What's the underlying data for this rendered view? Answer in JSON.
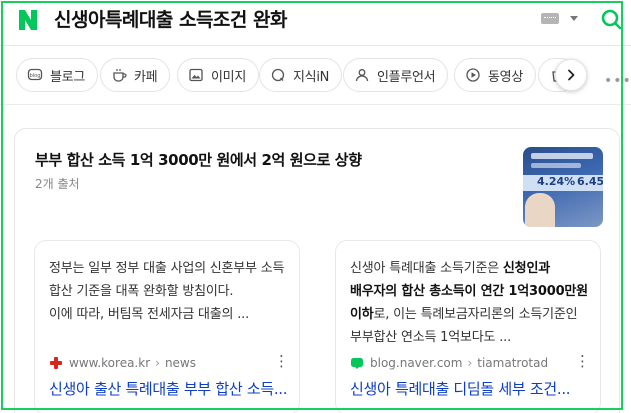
{
  "search": {
    "query": "신생아특례대출 소득조건 완화",
    "logo_letter": "N"
  },
  "tabs": [
    {
      "label": "블로그",
      "icon": "blog-icon"
    },
    {
      "label": "카페",
      "icon": "cafe-icon"
    },
    {
      "label": "이미지",
      "icon": "image-icon"
    },
    {
      "label": "지식iN",
      "icon": "knowledge-icon"
    },
    {
      "label": "인플루언서",
      "icon": "influencer-icon"
    },
    {
      "label": "동영상",
      "icon": "video-icon"
    }
  ],
  "card": {
    "title": "부부 합산 소득 1억 3000만 원에서 2억 원으로 상향",
    "sources_count": "2개 출처",
    "thumbnail": {
      "rate1": "4.24%",
      "rate2": "6.45"
    },
    "items": [
      {
        "snippet": "정부는 일부 정부 대출 사업의 신혼부부 소득 합산 기준을 대폭 완화할 방침이다.\n이에 따라, 버팀목 전세자금 대출의 ...",
        "source_domain": "www.korea.kr",
        "source_path": "news",
        "title": "신생아 출산 특례대출 부부 합산 소득..."
      },
      {
        "snippet_pre": "신생아 특례대출 소득기준은 ",
        "snippet_bold": "신청인과 배우자의 합산 총소득이 연간 1억3000만원 이하",
        "snippet_post": "로, 이는 특례보금자리론의 소득기준인 부부합산 연소득 1억보다도 ...",
        "source_domain": "blog.naver.com",
        "source_path": "tiamatrotad",
        "title": "신생아 특례대출 디딤돌 세부 조건..."
      }
    ]
  },
  "colors": {
    "brand": "#03c75a",
    "link": "#0c3ec9",
    "frame": "#19ce60"
  }
}
